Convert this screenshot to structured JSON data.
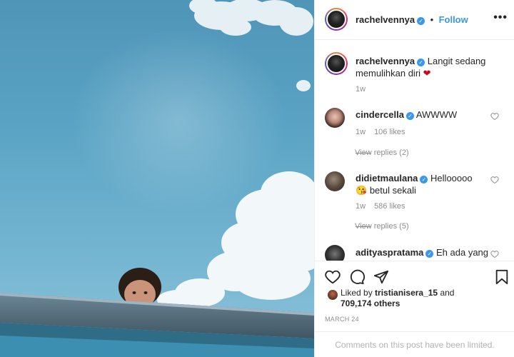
{
  "post": {
    "author": "rachelvennya",
    "follow_label": "Follow",
    "dot": "•",
    "verified_mark": "✓"
  },
  "caption": {
    "username": "rachelvennya",
    "text": "Langit sedang memulihkan diri",
    "emoji": "❤",
    "age": "1w"
  },
  "comments": [
    {
      "username": "cindercella",
      "text": "AWWWW",
      "age": "1w",
      "likes": "106 likes",
      "replies": "View replies (2)"
    },
    {
      "username": "didietmaulana",
      "text": "Hellooooo",
      "text2": "betul sekali",
      "emoji": "😘",
      "age": "1w",
      "likes": "586 likes",
      "replies": "View replies (5)"
    },
    {
      "username": "adityaspratama",
      "text": "Eh ada yang"
    }
  ],
  "likes": {
    "prefix": "Liked by",
    "user": "tristianisera_15",
    "and": "and",
    "count": "709,174 others"
  },
  "date": "MARCH 24",
  "limited_text": "Comments on this post have been limited.",
  "colors": {
    "accent": "#3897f0",
    "like_red": "#ed4956",
    "sky": "#5aa3c4"
  },
  "icons": [
    "heart-icon",
    "comment-icon",
    "share-icon",
    "bookmark-icon",
    "more-icon",
    "verified-icon"
  ]
}
